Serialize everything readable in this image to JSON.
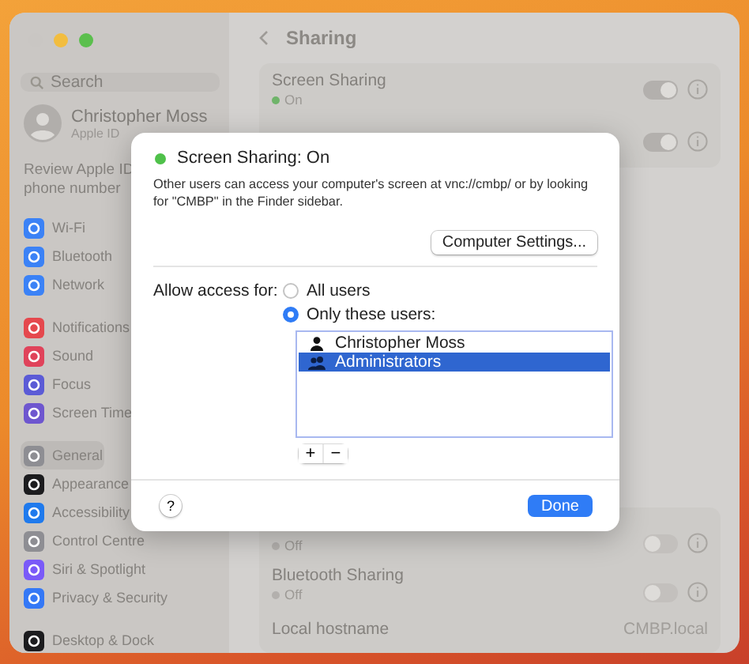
{
  "sidebar": {
    "search": {
      "placeholder": "Search"
    },
    "account": {
      "name": "Christopher Moss",
      "subtitle": "Apple ID"
    },
    "notice": "Review Apple ID phone number",
    "groups": [
      [
        {
          "label": "Wi-Fi",
          "color": "#3b82f6",
          "selected": false
        },
        {
          "label": "Bluetooth",
          "color": "#3b82f6",
          "selected": false
        },
        {
          "label": "Network",
          "color": "#3b82f6",
          "selected": false
        }
      ],
      [
        {
          "label": "Notifications",
          "color": "#e5484d",
          "selected": false
        },
        {
          "label": "Sound",
          "color": "#e0435a",
          "selected": false
        },
        {
          "label": "Focus",
          "color": "#5b5bd6",
          "selected": false
        },
        {
          "label": "Screen Time",
          "color": "#6e56cf",
          "selected": false
        }
      ],
      [
        {
          "label": "General",
          "color": "#8e8e93",
          "selected": true
        },
        {
          "label": "Appearance",
          "color": "#1c1c1e",
          "selected": false
        },
        {
          "label": "Accessibility",
          "color": "#1f7aed",
          "selected": false
        },
        {
          "label": "Control Centre",
          "color": "#8e8e93",
          "selected": false
        },
        {
          "label": "Siri & Spotlight",
          "color": "#7a5af8",
          "selected": false
        },
        {
          "label": "Privacy & Security",
          "color": "#3478f6",
          "selected": false
        }
      ],
      [
        {
          "label": "Desktop & Dock",
          "color": "#1c1c1e",
          "selected": false
        }
      ]
    ]
  },
  "pane": {
    "title": "Sharing",
    "upper_rows": [
      {
        "kind": "toggle",
        "title": "Screen Sharing",
        "status": "On",
        "on": true
      },
      {
        "kind": "toggle",
        "on": true
      }
    ],
    "lower_rows": [
      {
        "kind": "toggle",
        "status": "Off",
        "on": false
      },
      {
        "kind": "toggle",
        "title": "Bluetooth Sharing",
        "status": "Off",
        "on": false
      },
      {
        "kind": "value",
        "title": "Local hostname",
        "value": "CMBP.local"
      }
    ]
  },
  "dialog": {
    "status": {
      "text": "Screen Sharing: On",
      "on": true
    },
    "description": "Other users can access your computer's screen at vnc://cmbp/ or by looking for \"CMBP\" in the Finder sidebar.",
    "settings_button": "Computer Settings...",
    "access_label": "Allow access for:",
    "options": [
      {
        "label": "All users",
        "selected": false
      },
      {
        "label": "Only these users:",
        "selected": true
      }
    ],
    "users": [
      {
        "name": "Christopher Moss",
        "kind": "user",
        "selected": false
      },
      {
        "name": "Administrators",
        "kind": "group",
        "selected": true
      }
    ],
    "add_button": "+",
    "remove_button": "−",
    "help_button": "?",
    "done_button": "Done"
  }
}
